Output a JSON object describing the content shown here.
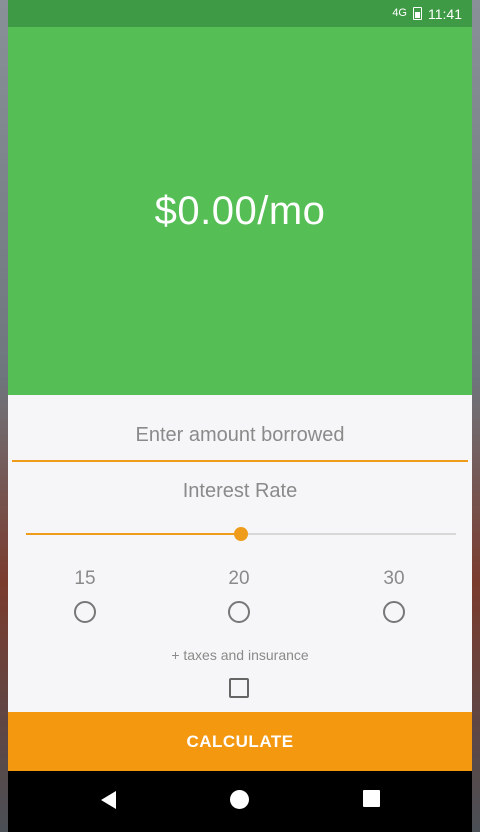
{
  "status_bar": {
    "network": "4G",
    "time": "11:41"
  },
  "header": {
    "monthly_payment": "$0.00/mo"
  },
  "form": {
    "amount_placeholder": "Enter amount borrowed",
    "interest_label": "Interest Rate",
    "interest_slider_fraction": 0.5,
    "terms": [
      {
        "label": "15",
        "selected": false
      },
      {
        "label": "20",
        "selected": false
      },
      {
        "label": "30",
        "selected": false
      }
    ],
    "taxes_label": "+ taxes and insurance",
    "taxes_checked": false,
    "calculate_label": "CALCULATE"
  },
  "colors": {
    "header_green": "#55be55",
    "status_green": "#3f9a46",
    "accent_orange": "#f4980f"
  },
  "nav": {
    "icons": [
      "back-icon",
      "home-icon",
      "recents-icon"
    ]
  }
}
